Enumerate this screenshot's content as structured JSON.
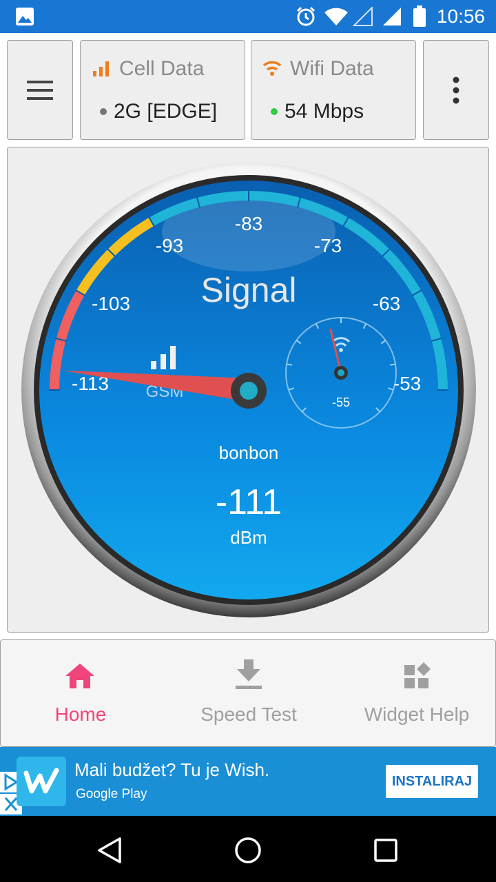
{
  "status_bar": {
    "time": "10:56",
    "icons": [
      "image-icon",
      "alarm-icon",
      "wifi-icon",
      "cell-signal-icon",
      "cell-signal-icon",
      "battery-icon"
    ],
    "color": "#1976d2"
  },
  "header": {
    "menu_icon": "hamburger-menu-icon",
    "cell": {
      "title": "Cell Data",
      "value": "2G [EDGE]",
      "icon": "cell-bars-icon",
      "dot_color": "#757575"
    },
    "wifi": {
      "title": "Wifi Data",
      "value": "54 Mbps",
      "icon": "wifi-icon",
      "dot_color": "#2ecc40"
    },
    "overflow_icon": "more-vert-icon"
  },
  "gauge": {
    "title": "Signal",
    "ticks": [
      "-113",
      "-103",
      "-93",
      "-83",
      "-73",
      "-63",
      "-53"
    ],
    "network_type": "GSM",
    "network_name": "bonbon",
    "value": "-111",
    "unit": "dBm",
    "reading": -111,
    "min": -113,
    "max": -53,
    "sub_gauge": {
      "value": "-55",
      "reading": -55
    },
    "colors": {
      "face": "#0a7fd6",
      "arc": "#1fb4d8",
      "needle": "#e05050",
      "low": "#f06060",
      "mid": "#f5c020"
    }
  },
  "nav": {
    "items": [
      {
        "label": "Home",
        "icon": "home-icon",
        "active": true
      },
      {
        "label": "Speed Test",
        "icon": "download-icon",
        "active": false
      },
      {
        "label": "Widget Help",
        "icon": "widgets-icon",
        "active": false
      }
    ],
    "active_color": "#f0457a",
    "inactive_color": "#a0a0a0"
  },
  "ad": {
    "title": "Mali budžet? Tu je Wish.",
    "subtitle": "Google Play",
    "cta": "INSTALIRAJ",
    "logo_icon": "wish-logo-icon",
    "adchoices_icon": "adchoices-icon",
    "close_icon": "close-icon"
  },
  "system_nav": {
    "icons": [
      "back-icon",
      "home-circle-icon",
      "recents-icon"
    ]
  }
}
